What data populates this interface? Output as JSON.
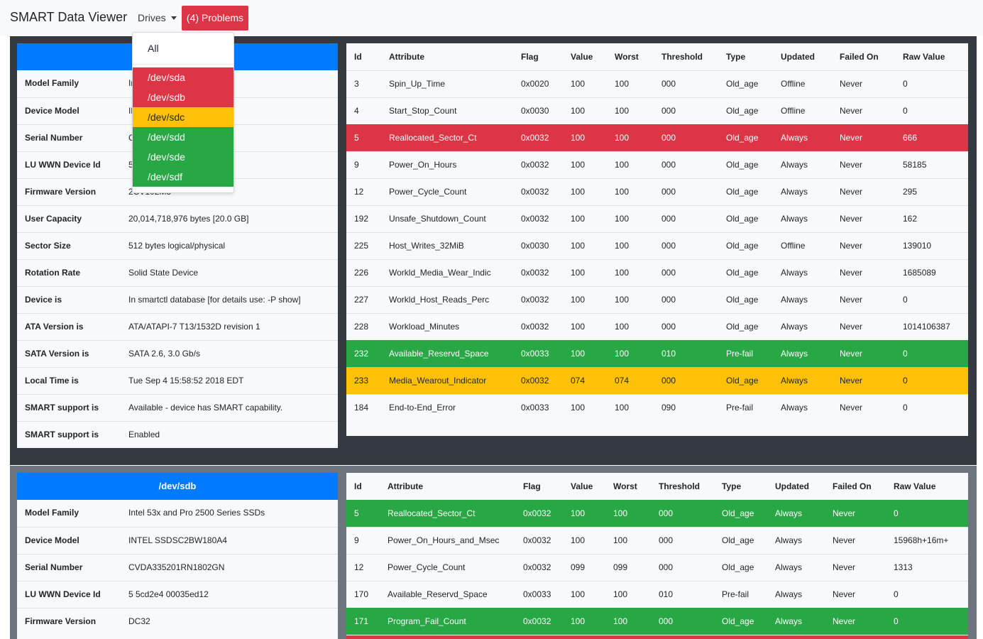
{
  "navbar": {
    "brand": "SMART Data Viewer",
    "drives_label": "Drives",
    "problems_label": "(4) Problems"
  },
  "dropdown": {
    "all_label": "All",
    "items": [
      {
        "label": "/dev/sda",
        "status": "red"
      },
      {
        "label": "/dev/sdb",
        "status": "red"
      },
      {
        "label": "/dev/sdc",
        "status": "yellow"
      },
      {
        "label": "/dev/sdd",
        "status": "green"
      },
      {
        "label": "/dev/sde",
        "status": "green"
      },
      {
        "label": "/dev/sdf",
        "status": "green"
      }
    ]
  },
  "colors": {
    "danger": "#dc3545",
    "success": "#28a745",
    "warning": "#ffc107",
    "primary": "#007bff",
    "dark": "#343a40",
    "secondary": "#6c757d"
  },
  "columns": [
    "Id",
    "Attribute",
    "Flag",
    "Value",
    "Worst",
    "Threshold",
    "Type",
    "Updated",
    "Failed On",
    "Raw Value"
  ],
  "drives": [
    {
      "name": "",
      "info": [
        {
          "label": "Model Family",
          "value": "In"
        },
        {
          "label": "Device Model",
          "value": "IN"
        },
        {
          "label": "Serial Number",
          "value": "C"
        },
        {
          "label": "LU WWN Device Id",
          "value": "5"
        },
        {
          "label": "Firmware Version",
          "value": "2CV102M3"
        },
        {
          "label": "User Capacity",
          "value": "20,014,718,976 bytes [20.0 GB]"
        },
        {
          "label": "Sector Size",
          "value": "512 bytes logical/physical"
        },
        {
          "label": "Rotation Rate",
          "value": "Solid State Device"
        },
        {
          "label": "Device is",
          "value": "In smartctl database [for details use: -P show]"
        },
        {
          "label": "ATA Version is",
          "value": "ATA/ATAPI-7 T13/1532D revision 1"
        },
        {
          "label": "SATA Version is",
          "value": "SATA 2.6, 3.0 Gb/s"
        },
        {
          "label": "Local Time is",
          "value": "Tue Sep 4 15:58:52 2018 EDT"
        },
        {
          "label": "SMART support is",
          "value": "Available - device has SMART capability."
        },
        {
          "label": "SMART support is",
          "value": "Enabled"
        }
      ],
      "attributes": [
        {
          "id": "3",
          "name": "Spin_Up_Time",
          "flag": "0x0020",
          "value": "100",
          "worst": "100",
          "threshold": "000",
          "type": "Old_age",
          "updated": "Offline",
          "failed_on": "Never",
          "raw": "0",
          "status": ""
        },
        {
          "id": "4",
          "name": "Start_Stop_Count",
          "flag": "0x0030",
          "value": "100",
          "worst": "100",
          "threshold": "000",
          "type": "Old_age",
          "updated": "Offline",
          "failed_on": "Never",
          "raw": "0",
          "status": ""
        },
        {
          "id": "5",
          "name": "Reallocated_Sector_Ct",
          "flag": "0x0032",
          "value": "100",
          "worst": "100",
          "threshold": "000",
          "type": "Old_age",
          "updated": "Always",
          "failed_on": "Never",
          "raw": "666",
          "status": "red"
        },
        {
          "id": "9",
          "name": "Power_On_Hours",
          "flag": "0x0032",
          "value": "100",
          "worst": "100",
          "threshold": "000",
          "type": "Old_age",
          "updated": "Always",
          "failed_on": "Never",
          "raw": "58185",
          "status": ""
        },
        {
          "id": "12",
          "name": "Power_Cycle_Count",
          "flag": "0x0032",
          "value": "100",
          "worst": "100",
          "threshold": "000",
          "type": "Old_age",
          "updated": "Always",
          "failed_on": "Never",
          "raw": "295",
          "status": ""
        },
        {
          "id": "192",
          "name": "Unsafe_Shutdown_Count",
          "flag": "0x0032",
          "value": "100",
          "worst": "100",
          "threshold": "000",
          "type": "Old_age",
          "updated": "Always",
          "failed_on": "Never",
          "raw": "162",
          "status": ""
        },
        {
          "id": "225",
          "name": "Host_Writes_32MiB",
          "flag": "0x0030",
          "value": "100",
          "worst": "100",
          "threshold": "000",
          "type": "Old_age",
          "updated": "Offline",
          "failed_on": "Never",
          "raw": "139010",
          "status": ""
        },
        {
          "id": "226",
          "name": "Workld_Media_Wear_Indic",
          "flag": "0x0032",
          "value": "100",
          "worst": "100",
          "threshold": "000",
          "type": "Old_age",
          "updated": "Always",
          "failed_on": "Never",
          "raw": "1685089",
          "status": ""
        },
        {
          "id": "227",
          "name": "Workld_Host_Reads_Perc",
          "flag": "0x0032",
          "value": "100",
          "worst": "100",
          "threshold": "000",
          "type": "Old_age",
          "updated": "Always",
          "failed_on": "Never",
          "raw": "0",
          "status": ""
        },
        {
          "id": "228",
          "name": "Workload_Minutes",
          "flag": "0x0032",
          "value": "100",
          "worst": "100",
          "threshold": "000",
          "type": "Old_age",
          "updated": "Always",
          "failed_on": "Never",
          "raw": "1014106387",
          "status": ""
        },
        {
          "id": "232",
          "name": "Available_Reservd_Space",
          "flag": "0x0033",
          "value": "100",
          "worst": "100",
          "threshold": "010",
          "type": "Pre-fail",
          "updated": "Always",
          "failed_on": "Never",
          "raw": "0",
          "status": "green"
        },
        {
          "id": "233",
          "name": "Media_Wearout_Indicator",
          "flag": "0x0032",
          "value": "074",
          "worst": "074",
          "threshold": "000",
          "type": "Old_age",
          "updated": "Always",
          "failed_on": "Never",
          "raw": "0",
          "status": "yellow"
        },
        {
          "id": "184",
          "name": "End-to-End_Error",
          "flag": "0x0033",
          "value": "100",
          "worst": "100",
          "threshold": "090",
          "type": "Pre-fail",
          "updated": "Always",
          "failed_on": "Never",
          "raw": "0",
          "status": ""
        }
      ]
    },
    {
      "name": "/dev/sdb",
      "info": [
        {
          "label": "Model Family",
          "value": "Intel 53x and Pro 2500 Series SSDs"
        },
        {
          "label": "Device Model",
          "value": "INTEL SSDSC2BW180A4"
        },
        {
          "label": "Serial Number",
          "value": "CVDA335201RN1802GN"
        },
        {
          "label": "LU WWN Device Id",
          "value": "5 5cd2e4 00035ed12"
        },
        {
          "label": "Firmware Version",
          "value": "DC32"
        }
      ],
      "attributes": [
        {
          "id": "5",
          "name": "Reallocated_Sector_Ct",
          "flag": "0x0032",
          "value": "100",
          "worst": "100",
          "threshold": "000",
          "type": "Old_age",
          "updated": "Always",
          "failed_on": "Never",
          "raw": "0",
          "status": "green"
        },
        {
          "id": "9",
          "name": "Power_On_Hours_and_Msec",
          "flag": "0x0032",
          "value": "100",
          "worst": "100",
          "threshold": "000",
          "type": "Old_age",
          "updated": "Always",
          "failed_on": "Never",
          "raw": "15968h+16m+",
          "status": ""
        },
        {
          "id": "12",
          "name": "Power_Cycle_Count",
          "flag": "0x0032",
          "value": "099",
          "worst": "099",
          "threshold": "000",
          "type": "Old_age",
          "updated": "Always",
          "failed_on": "Never",
          "raw": "1313",
          "status": ""
        },
        {
          "id": "170",
          "name": "Available_Reservd_Space",
          "flag": "0x0033",
          "value": "100",
          "worst": "100",
          "threshold": "010",
          "type": "Pre-fail",
          "updated": "Always",
          "failed_on": "Never",
          "raw": "0",
          "status": ""
        },
        {
          "id": "171",
          "name": "Program_Fail_Count",
          "flag": "0x0032",
          "value": "100",
          "worst": "100",
          "threshold": "000",
          "type": "Old_age",
          "updated": "Always",
          "failed_on": "Never",
          "raw": "0",
          "status": "green"
        }
      ]
    }
  ]
}
